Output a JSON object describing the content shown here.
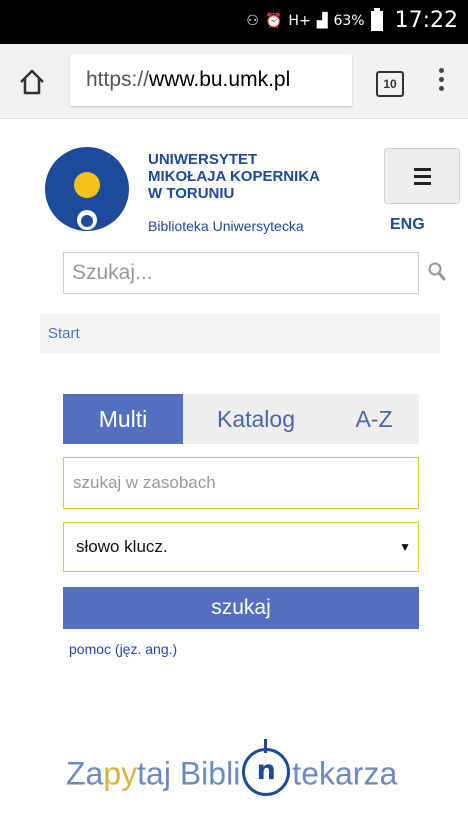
{
  "status_bar": {
    "battery": "63%",
    "time": "17:22"
  },
  "browser": {
    "url_scheme": "https://",
    "url_host": "www.bu.umk.pl",
    "tab_count": "10"
  },
  "header": {
    "university_line1": "UNIWERSYTET",
    "university_line2": "MIKOŁAJA KOPERNIKA",
    "university_line3": "W TORUNIU",
    "library_name": "Biblioteka Uniwersytecka",
    "lang_link": "ENG"
  },
  "site_search": {
    "placeholder": "Szukaj..."
  },
  "breadcrumb": {
    "start": "Start"
  },
  "catalog": {
    "tabs": [
      {
        "label": "Multi",
        "active": true
      },
      {
        "label": "Katalog",
        "active": false
      },
      {
        "label": "A-Z",
        "active": false
      }
    ],
    "resource_placeholder": "szukaj w zasobach",
    "select_value": "słowo klucz.",
    "submit_label": "szukaj",
    "help_link": "pomoc (jęz. ang.)"
  },
  "ask_librarian": {
    "part1": "Za",
    "part_y": "py",
    "part2": "taj Bibli",
    "badge_letter": "n",
    "part3": "tekarza"
  },
  "colors": {
    "brand_blue": "#1d4a9a",
    "tab_active": "#546fc0",
    "input_border": "#e8c73a",
    "logo_yellow": "#f4c21b"
  }
}
